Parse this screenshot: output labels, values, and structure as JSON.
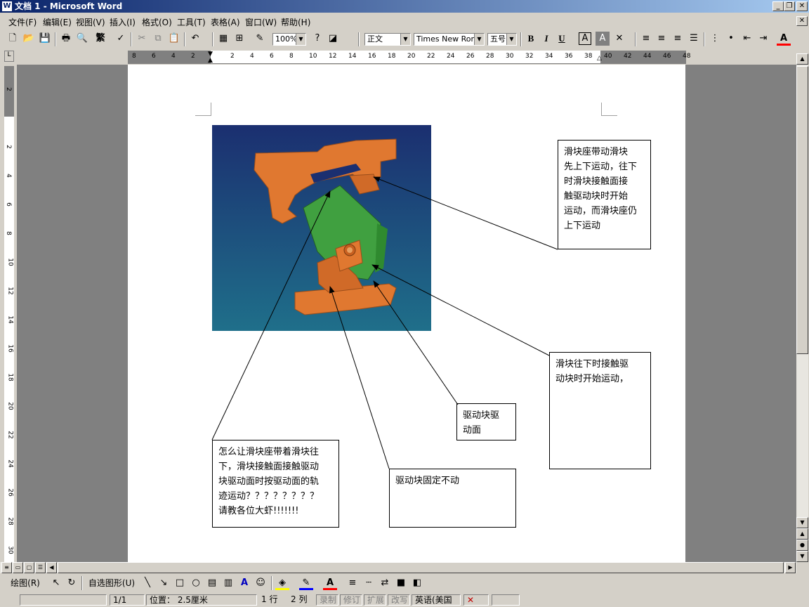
{
  "window": {
    "title": "文档 1 - Microsoft Word",
    "controls": [
      "_",
      "❐",
      "✕"
    ],
    "doc_controls": [
      "✕"
    ]
  },
  "menu": [
    "文件(F)",
    "编辑(E)",
    "视图(V)",
    "插入(I)",
    "格式(O)",
    "工具(T)",
    "表格(A)",
    "窗口(W)",
    "帮助(H)"
  ],
  "toolbar": {
    "zoom": "100%",
    "style": "正文",
    "font": "Times New Roman",
    "size": "五号",
    "bold": "B",
    "italic": "I",
    "underline": "U",
    "font_color_label": "A",
    "fanti": "繁"
  },
  "ruler": {
    "h_labels": [
      "8",
      "6",
      "4",
      "2",
      "",
      "2",
      "4",
      "6",
      "8",
      "10",
      "12",
      "14",
      "16",
      "18",
      "20",
      "22",
      "24",
      "26",
      "28",
      "30",
      "32",
      "34",
      "36",
      "38",
      "40",
      "42",
      "44",
      "46",
      "48"
    ],
    "v_labels": [
      "2",
      "",
      "2",
      "4",
      "6",
      "8",
      "10",
      "12",
      "14",
      "16",
      "18",
      "20",
      "22",
      "24",
      "26",
      "28",
      "30"
    ]
  },
  "document": {
    "callouts": [
      {
        "id": "c1",
        "lines": [
          "滑块座带动滑块",
          "先上下运动，往下",
          "时滑块接触面接",
          "触驱动块时开始",
          "运动，而滑块座仍",
          "上下运动"
        ]
      },
      {
        "id": "c2",
        "lines": [
          "滑块往下时接触驱",
          "动块时开始运动，"
        ]
      },
      {
        "id": "c3",
        "lines": [
          "驱动块驱",
          "动面"
        ]
      },
      {
        "id": "c4",
        "lines": [
          "怎么让滑块座带着滑块往",
          "下，滑块接触面接触驱动",
          "块驱动面时按驱动面的轨",
          "迹运动？？？？？？？？",
          "请教各位大虾!!!!!!!"
        ]
      },
      {
        "id": "c5",
        "lines": [
          "驱动块固定不动"
        ]
      }
    ]
  },
  "drawing_toolbar": {
    "draw_label": "绘图(R)",
    "autoshape_label": "自选图形(U)"
  },
  "statusbar": {
    "page": "1/1",
    "position": "位置： 2.5厘米",
    "line": "1 行",
    "col": "2 列",
    "rec": "录制",
    "trk": "修订",
    "ext": "扩展",
    "ovr": "改写",
    "lang": "英语(美国"
  },
  "colors": {
    "titlebar_start": "#0a246a",
    "titlebar_end": "#a6caf0",
    "model_orange": "#e07830",
    "model_green": "#40a040",
    "render_bg_top": "#1b2f70",
    "render_bg_bottom": "#1f6f8a"
  }
}
